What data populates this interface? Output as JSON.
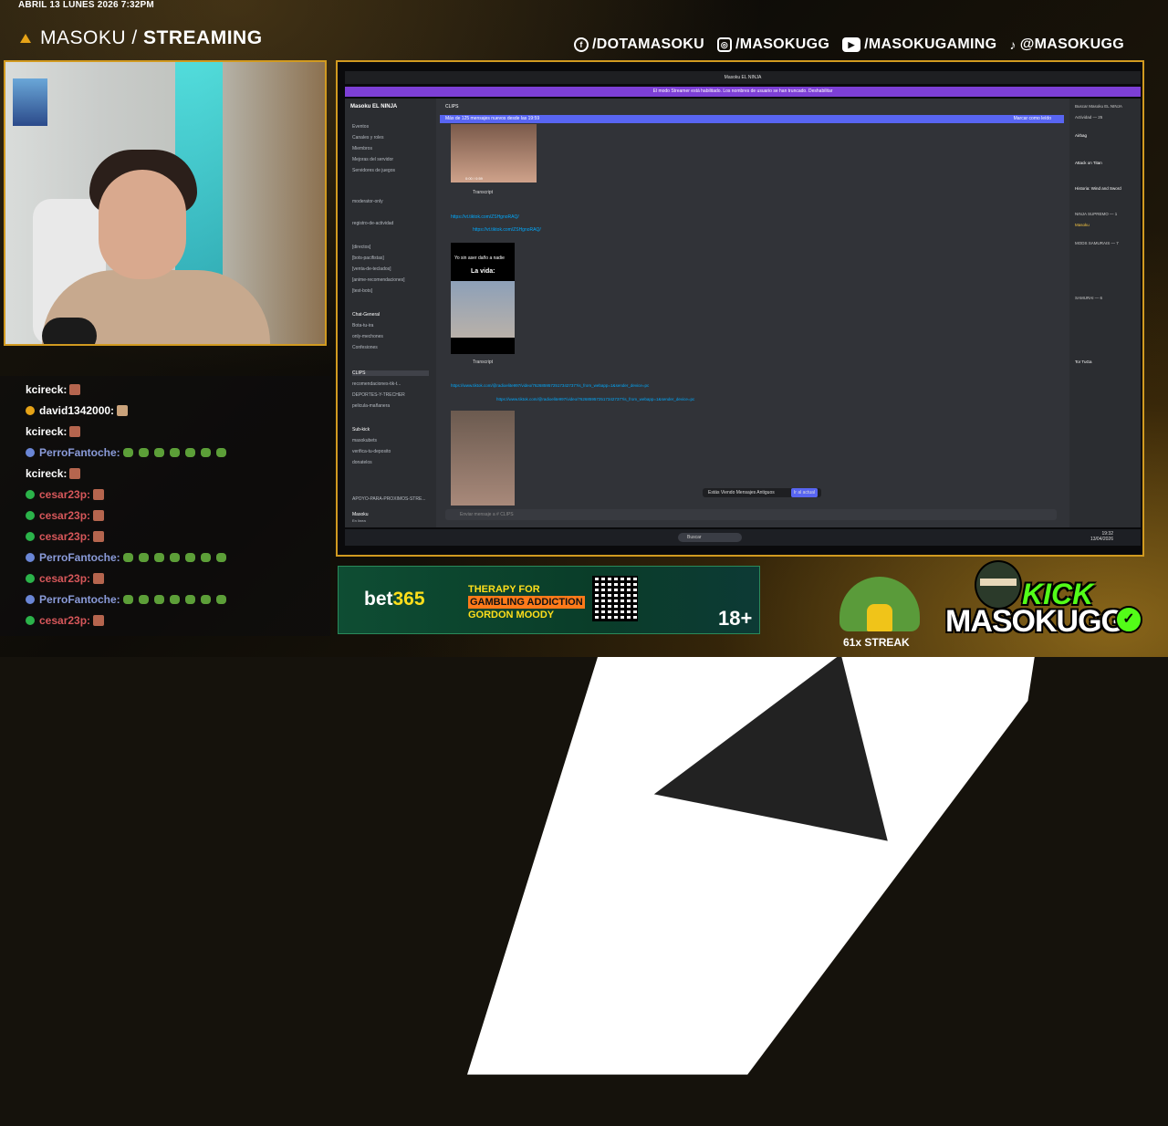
{
  "header": {
    "datetime": "ABRIL 13 LUNES 2026 7:32PM",
    "brand_light": "MASOKU / ",
    "brand_bold": "STREAMING"
  },
  "socials": [
    {
      "icon": "facebook-icon",
      "handle": "/DOTAMASOKU"
    },
    {
      "icon": "instagram-icon",
      "handle": "/MASOKUGG"
    },
    {
      "icon": "youtube-icon",
      "handle": "/MASOKUGAMING"
    },
    {
      "icon": "tiktok-icon",
      "handle": "@MASOKUGG"
    }
  ],
  "chat": [
    {
      "user": "kcireck:",
      "color": "#ffffff"
    },
    {
      "user": "david1342000:",
      "color": "#ffffff"
    },
    {
      "user": "kcireck:",
      "color": "#ffffff"
    },
    {
      "user": "PerroFantoche:",
      "color": "#8a9bd9"
    },
    {
      "user": "kcireck:",
      "color": "#ffffff"
    },
    {
      "user": "cesar23p:",
      "color": "#d6575a"
    },
    {
      "user": "cesar23p:",
      "color": "#d6575a"
    },
    {
      "user": "cesar23p:",
      "color": "#d6575a"
    },
    {
      "user": "PerroFantoche:",
      "color": "#8a9bd9"
    },
    {
      "user": "cesar23p:",
      "color": "#d6575a"
    },
    {
      "user": "PerroFantoche:",
      "color": "#8a9bd9"
    },
    {
      "user": "cesar23p:",
      "color": "#d6575a"
    }
  ],
  "discord": {
    "window_title": "Masoku EL NINJA",
    "banner": "El modo Streamer está habilitado. Los nombres de usuario se han truncado.  Deshabilitar",
    "server_name": "Masoku EL NINJA",
    "channel_header": "CLIPS",
    "new_messages": "Más de 125 mensajes nuevos desde las 19:59",
    "mark_read": "Marcar como leído",
    "channels": [
      "Eventos",
      "Canales y roles",
      "Miembros",
      "Mejoras del servidor",
      "Servidores de juegos",
      "moderator-only",
      "registro-de-actividad",
      "[directos]",
      "[bots-pacifistas]",
      "[venta-de-teclados]",
      "[anime-recomendaciones]",
      "[test-bots]",
      "Chat-General",
      "Bota-tu-ira",
      "only-mechones",
      "Confesiones",
      "CLIPS",
      "recomendaciones-tik-t...",
      "DEPORTES-Y-TRECHER",
      "pelicula-mañanera",
      "Sub-kick",
      "masokubets",
      "verifica-tu-deposito",
      "donatelos",
      "APOYO-PARA-PROXIMOS-STRE..."
    ],
    "links": [
      "https://vt.tiktok.com/ZSHgnoRAQ/",
      "https://vt.tiktok.com/ZSHgnoRAQ/",
      "https://www.tiktok.com/@radioelite997/video/7626859572517342737?is_from_webapp=1&sender_device=pc",
      "https://www.tiktok.com/@radioelite997/video/7626859572517342737?is_from_webapp=1&sender_device=pc"
    ],
    "transcript": "Transcript",
    "video_text_1": "Yo sin aser daño a nadie",
    "video_text_2": "La vida:",
    "video_time": "0:00 / 0:59",
    "old_messages": "Estás Viendo Mensajes Antiguos",
    "jump_present": "Ir al actual",
    "input_placeholder": "Enviar mensaje a # CLIPS",
    "user_name": "Masoku",
    "user_status": "En línea",
    "member_search": "Buscar Masoku EL NINJA",
    "activity_header": "Actividad — 25",
    "members": [
      "Airbag",
      "Attack on Titan",
      "Historia: Wind and Sword",
      "NINJA SUPREMO — 1",
      "Masoku",
      "MODS SAMURAIS — 7",
      "SAMURAI — 6",
      "Tor TuGa"
    ],
    "taskbar_search": "Buscar",
    "clock_time": "19:32",
    "clock_date": "13/04/2026"
  },
  "ad": {
    "brand": "bet",
    "brand_num": "365",
    "therapy_1": "THERAPY FOR",
    "therapy_2": "GAMBLING ADDICTION",
    "therapy_3": "GORDON MOODY",
    "age": "18+"
  },
  "streak": "61x STREAK",
  "kick": {
    "label": "KICK",
    "name": "MASOKUGG"
  },
  "colors": {
    "accent": "#d19a20",
    "discord_banner": "#7d3fd6",
    "kick_green": "#53fc18"
  }
}
